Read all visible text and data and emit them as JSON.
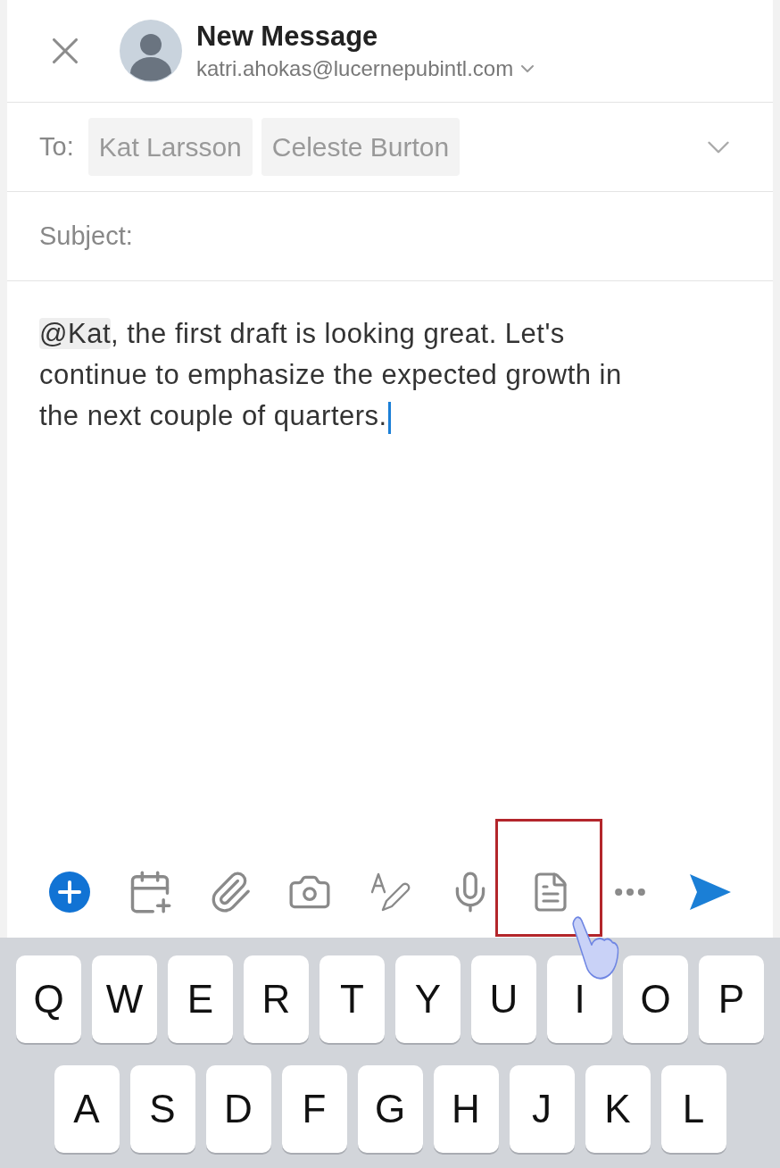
{
  "header": {
    "title": "New Message",
    "account": "katri.ahokas@lucernepubintl.com"
  },
  "to": {
    "label": "To:",
    "recipients": [
      "Kat Larsson",
      "Celeste Burton"
    ]
  },
  "subject": {
    "placeholder": "Subject:"
  },
  "body": {
    "mention": "@Kat",
    "text": ", the first draft is looking great. Let's continue to emphasize the expected growth in the next couple of quarters."
  },
  "toolbar": [
    {
      "kind": "add",
      "highlighted": false
    },
    {
      "kind": "event",
      "highlighted": false
    },
    {
      "kind": "attach",
      "highlighted": false
    },
    {
      "kind": "camera",
      "highlighted": false
    },
    {
      "kind": "draw",
      "highlighted": false
    },
    {
      "kind": "dictate",
      "highlighted": false
    },
    {
      "kind": "template",
      "highlighted": true
    },
    {
      "kind": "more",
      "highlighted": false
    },
    {
      "kind": "send",
      "highlighted": false
    }
  ],
  "keyboard": [
    [
      "Q",
      "W",
      "E",
      "R",
      "T",
      "Y",
      "U",
      "I",
      "O",
      "P"
    ],
    [
      "A",
      "S",
      "D",
      "F",
      "G",
      "H",
      "J",
      "K",
      "L"
    ]
  ]
}
